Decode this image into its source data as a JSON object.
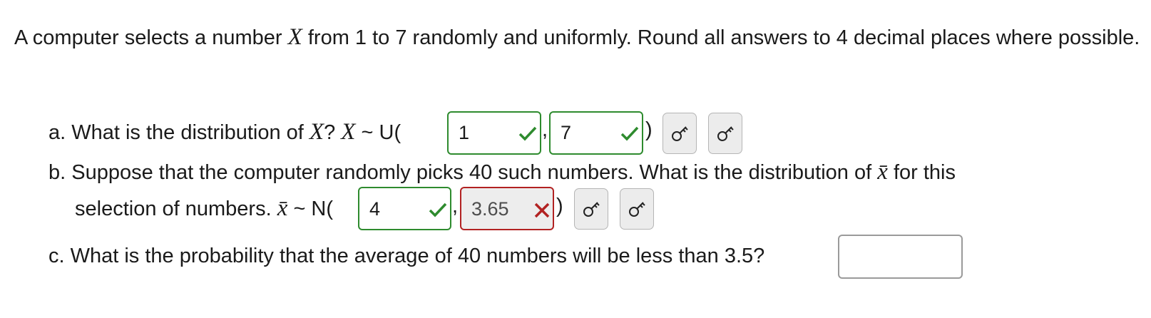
{
  "question": {
    "intro_a": "A computer selects a number",
    "var": "X",
    "intro_b": "from 1 to 7 randomly and uniformly. Round all answers to 4 decimal places where possible."
  },
  "part_a": {
    "prefix": "a. What is the distribution of",
    "var": "X",
    "qmark": "?",
    "dist": "~ U(",
    "sep": ",",
    "close": ")",
    "input1": {
      "value": "1",
      "status": "correct"
    },
    "input2": {
      "value": "7",
      "status": "correct"
    }
  },
  "part_b": {
    "line1": "b. Suppose that the computer randomly picks 40 such numbers.  What is the distribution of",
    "line1_end": "for this",
    "line2": "selection of numbers.",
    "xbar": "x̄",
    "dist": "~ N(",
    "sep": ",",
    "close": ")",
    "input1": {
      "value": "4",
      "status": "correct"
    },
    "input2": {
      "value": "3.65",
      "status": "incorrect"
    }
  },
  "part_c": {
    "text": "c. What is the probability that the average of 40 numbers will be less than 3.5?",
    "input": {
      "value": ""
    }
  },
  "icons": {
    "key": "key-icon",
    "check": "check-icon",
    "cross": "cross-icon"
  },
  "colors": {
    "correct": "#2e8b2e",
    "incorrect": "#b22222"
  }
}
